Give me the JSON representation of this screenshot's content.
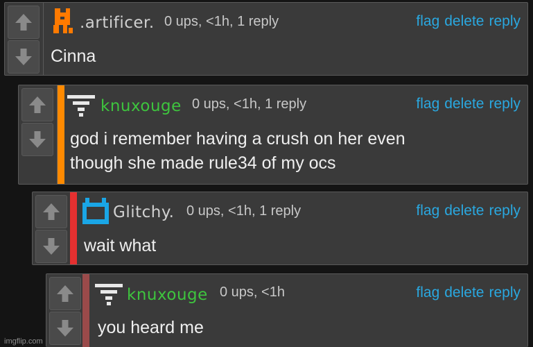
{
  "colors": {
    "link": "#2aa8e0",
    "username_green": "#3ec43e",
    "username_gray": "#d0d0d0",
    "stripe_orange": "#ff8a00",
    "stripe_red": "#e53030",
    "stripe_brown": "#9a4a4a",
    "avatar_orange": "#ff7a00",
    "avatar_blue": "#1aa6e6"
  },
  "comments": [
    {
      "username": ".artificer.",
      "meta": "0 ups, <1h, 1 reply",
      "text_lines": [
        "Cinna"
      ],
      "avatar_icon": "orange-pixel-avatar-icon",
      "actions": {
        "flag": "flag",
        "delete": "delete",
        "reply": "reply"
      }
    },
    {
      "username": "knuxouge",
      "meta": "0 ups, <1h, 1 reply",
      "text_lines": [
        "god i remember having a crush on her even",
        "though she made rule34 of my ocs"
      ],
      "avatar_icon": "wifi-avatar-icon",
      "actions": {
        "flag": "flag",
        "delete": "delete",
        "reply": "reply"
      }
    },
    {
      "username": "Glitchy.",
      "meta": "0 ups, <1h, 1 reply",
      "text_lines": [
        "wait what"
      ],
      "avatar_icon": "blue-robot-avatar-icon",
      "actions": {
        "flag": "flag",
        "delete": "delete",
        "reply": "reply"
      }
    },
    {
      "username": "knuxouge",
      "meta": "0 ups, <1h",
      "text_lines": [
        "you heard me"
      ],
      "avatar_icon": "wifi-avatar-icon",
      "actions": {
        "flag": "flag",
        "delete": "delete",
        "reply": "reply"
      }
    }
  ],
  "watermark": "imgflip.com"
}
